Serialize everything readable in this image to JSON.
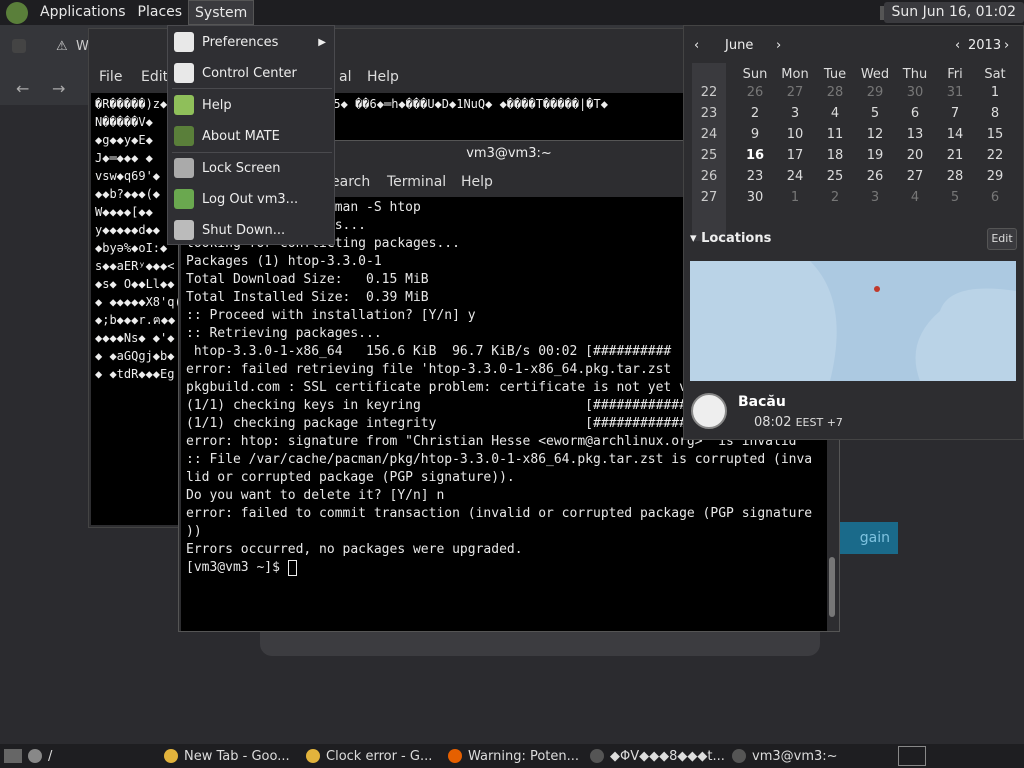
{
  "top_panel": {
    "applications": "Applications",
    "places": "Places",
    "system": "System",
    "clock": "Sun Jun 16, 01:02"
  },
  "system_menu": {
    "items": [
      {
        "label": "Preferences",
        "submenu": true,
        "icon": "preferences-icon"
      },
      {
        "label": "Control Center",
        "submenu": false,
        "icon": "control-center-icon"
      },
      {
        "label": "Help",
        "submenu": false,
        "icon": "help-icon"
      },
      {
        "label": "About MATE",
        "submenu": false,
        "icon": "about-mate-icon"
      },
      {
        "label": "Lock Screen",
        "submenu": false,
        "icon": "lock-screen-icon"
      },
      {
        "label": "Log Out vm3...",
        "submenu": false,
        "icon": "log-out-icon"
      },
      {
        "label": "Shut Down...",
        "submenu": false,
        "icon": "shutdown-icon"
      }
    ]
  },
  "back_terminal": {
    "menu": [
      "File",
      "Edit",
      "al",
      "Help"
    ],
    "lines": [
      "�R�����)z◆��������������������◆Ub5◆ ��6◆═h◆���U◆D◆1NuQ◆ ◆����T�����|�T◆",
      "N�����V◆",
      "◆g◆◆y◆E◆",
      "J◆═◆◆◆ ◆",
      "vsw◆q69'◆",
      "",
      "◆◆b?◆◆◆(◆",
      "W◆◆◆◆[◆◆",
      "y◆◆◆◆◆d◆◆",
      "◆byə%◆oI:◆",
      "",
      "s◆◆aERʸ◆◆◆<",
      "",
      "",
      "◆s◆ O◆◆Ll◆◆",
      "◆ ◆◆◆◆◆X8'q(",
      "",
      "◆;b◆◆◆r.ฅ◆◆",
      "◆◆◆◆Ns◆ ◆'◆",
      "",
      "◆ ◆aGQgj◆b◆",
      "",
      "◆ ◆tdR◆◆◆Eg"
    ]
  },
  "terminal": {
    "title": "vm3@vm3:~",
    "menu": [
      "earch",
      "Terminal",
      "Help"
    ],
    "lines": [
      "                 acman -S htop",
      "                 ies...",
      "looking for conflicting packages...",
      "",
      "Packages (1) htop-3.3.0-1",
      "",
      "Total Download Size:   0.15 MiB",
      "Total Installed Size:  0.39 MiB",
      "",
      ":: Proceed with installation? [Y/n] y",
      ":: Retrieving packages...",
      " htop-3.3.0-1-x86_64   156.6 KiB  96.7 KiB/s 00:02 [##########",
      "error: failed retrieving file 'htop-3.3.0-1-x86_64.pkg.tar.zst",
      "pkgbuild.com : SSL certificate problem: certificate is not yet valid",
      "(1/1) checking keys in keyring                     [######################] 100%",
      "(1/1) checking package integrity                   [######################] 100%",
      "error: htop: signature from \"Christian Hesse <eworm@archlinux.org>\" is invalid",
      ":: File /var/cache/pacman/pkg/htop-3.3.0-1-x86_64.pkg.tar.zst is corrupted (inva",
      "lid or corrupted package (PGP signature)).",
      "Do you want to delete it? [Y/n] n",
      "error: failed to commit transaction (invalid or corrupted package (PGP signature",
      "))",
      "Errors occurred, no packages were upgraded."
    ],
    "prompt": "[vm3@vm3 ~]$ "
  },
  "browser_fragment": {
    "tab_partial": "W",
    "button_partial": "gain"
  },
  "calendar": {
    "month": "June",
    "year": "2013",
    "prev": "‹",
    "next": "›",
    "weekdays": [
      "Sun",
      "Mon",
      "Tue",
      "Wed",
      "Thu",
      "Fri",
      "Sat"
    ],
    "weeks": [
      {
        "num": "22",
        "days": [
          "26",
          "27",
          "28",
          "29",
          "30",
          "31",
          "1"
        ],
        "other": [
          true,
          true,
          true,
          true,
          true,
          true,
          false
        ]
      },
      {
        "num": "23",
        "days": [
          "2",
          "3",
          "4",
          "5",
          "6",
          "7",
          "8"
        ],
        "other": [
          false,
          false,
          false,
          false,
          false,
          false,
          false
        ]
      },
      {
        "num": "24",
        "days": [
          "9",
          "10",
          "11",
          "12",
          "13",
          "14",
          "15"
        ],
        "other": [
          false,
          false,
          false,
          false,
          false,
          false,
          false
        ]
      },
      {
        "num": "25",
        "days": [
          "16",
          "17",
          "18",
          "19",
          "20",
          "21",
          "22"
        ],
        "other": [
          false,
          false,
          false,
          false,
          false,
          false,
          false
        ]
      },
      {
        "num": "26",
        "days": [
          "23",
          "24",
          "25",
          "26",
          "27",
          "28",
          "29"
        ],
        "other": [
          false,
          false,
          false,
          false,
          false,
          false,
          false
        ]
      },
      {
        "num": "27",
        "days": [
          "30",
          "1",
          "2",
          "3",
          "4",
          "5",
          "6"
        ],
        "other": [
          false,
          true,
          true,
          true,
          true,
          true,
          true
        ]
      }
    ],
    "today": "16",
    "locations_label": "Locations",
    "edit_label": "Edit",
    "city": "Bacău",
    "time": "08:02",
    "tz": "EEST +7"
  },
  "taskbar": {
    "items": [
      {
        "label": "/",
        "icon": "folder-icon"
      },
      {
        "label": "New Tab - Goo...",
        "icon": "chrome-icon"
      },
      {
        "label": "Clock error - G...",
        "icon": "chrome-icon"
      },
      {
        "label": "Warning: Poten...",
        "icon": "firefox-icon"
      },
      {
        "label": "◆ΦV◆◆◆8◆◆◆t...",
        "icon": "terminal-icon"
      },
      {
        "label": "vm3@vm3:~",
        "icon": "terminal-icon"
      }
    ]
  },
  "colors": {
    "panel": "#1e1e21",
    "accent": "#1a6a8a",
    "map_land": "#f2f4f6",
    "map_sea": "#b4cfe6"
  }
}
